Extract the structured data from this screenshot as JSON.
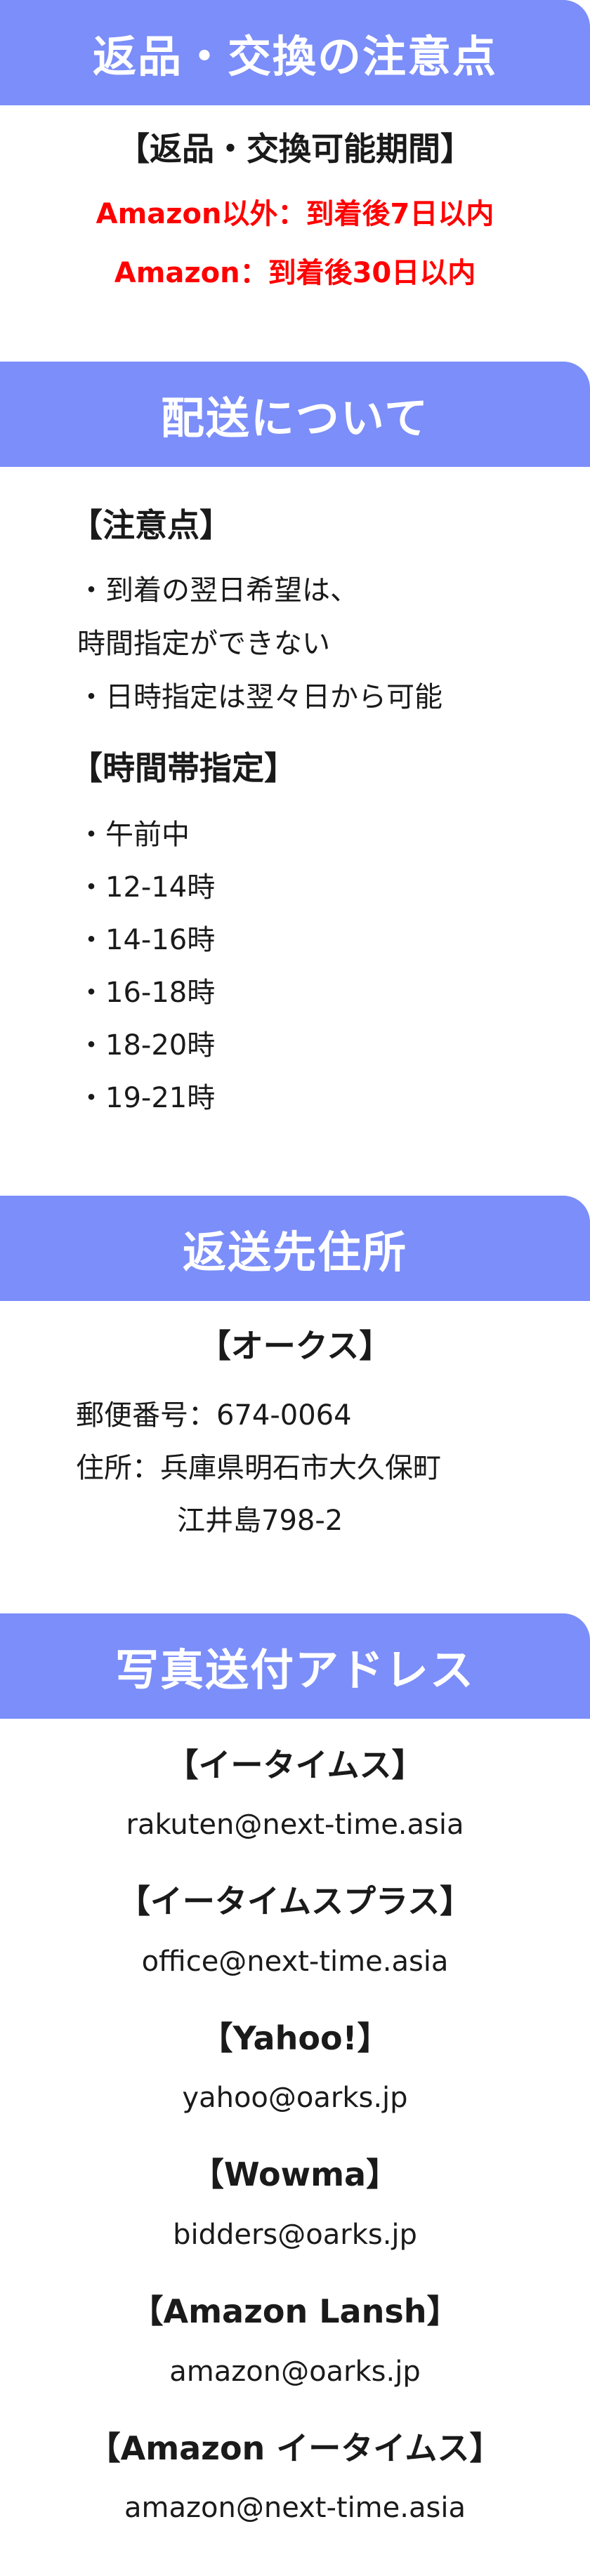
{
  "returns": {
    "header": "返品・交換の注意点",
    "period_title": "【返品・交換可能期間】",
    "rule_other": "Amazon以外：到着後7日以内",
    "rule_amazon": "Amazon：到着後30日以内"
  },
  "shipping": {
    "header": "配送について",
    "notes_title": "【注意点】",
    "note_1a": "・到着の翌日希望は、",
    "note_1b": "時間指定ができない",
    "note_2": "・日時指定は翌々日から可能",
    "slots_title": "【時間帯指定】",
    "slots": [
      "・午前中",
      "・12-14時",
      "・14-16時",
      "・16-18時",
      "・18-20時",
      "・19-21時"
    ]
  },
  "return_address": {
    "header": "返送先住所",
    "company": "【オークス】",
    "postal": "郵便番号：674-0064",
    "address_1": "住所：兵庫県明石市大久保町",
    "address_2": "江井島798-2"
  },
  "photo_addresses": {
    "header": "写真送付アドレス",
    "entries": [
      {
        "store": "【イータイムス】",
        "email": "rakuten@next-time.asia"
      },
      {
        "store": "【イータイムスプラス】",
        "email": "office@next-time.asia"
      },
      {
        "store": "【Yahoo!】",
        "email": "yahoo@oarks.jp"
      },
      {
        "store": "【Wowma】",
        "email": "bidders@oarks.jp"
      },
      {
        "store": "【Amazon Lansh】",
        "email": "amazon@oarks.jp"
      },
      {
        "store": "【Amazon イータイムス】",
        "email": "amazon@next-time.asia"
      }
    ]
  },
  "colors": {
    "header_bg": "#7b8ef9",
    "header_text": "#ffffff",
    "alert_text": "#ff0000",
    "body_text": "#1a1a1a"
  }
}
